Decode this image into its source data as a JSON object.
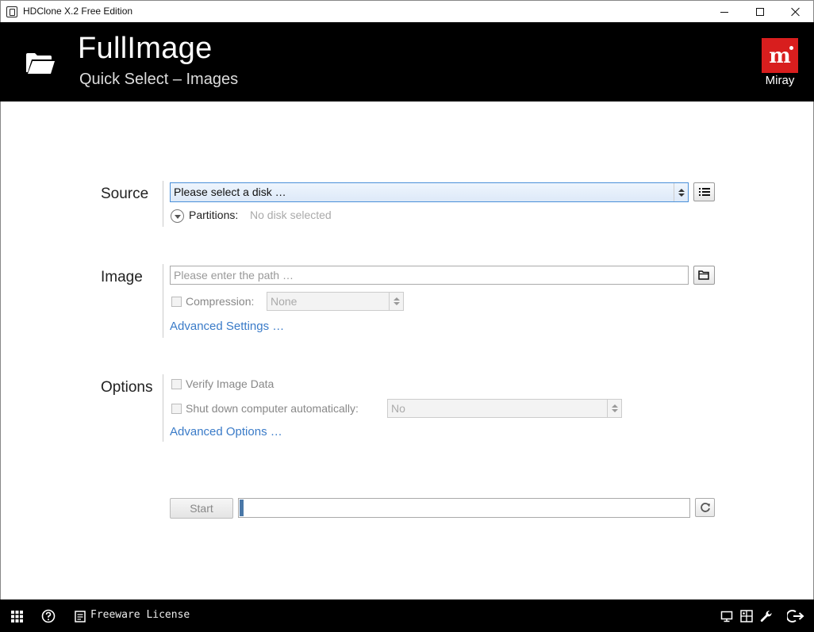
{
  "window": {
    "title": "HDClone X.2 Free Edition"
  },
  "header": {
    "title": "FullImage",
    "subtitle": "Quick Select – Images",
    "brand": "Miray",
    "brand_letter": "m",
    "brand_color": "#d81e1e"
  },
  "source": {
    "label": "Source",
    "disk_select_value": "Please select a disk …",
    "partitions_label": "Partitions:",
    "partitions_value": "No disk selected"
  },
  "image": {
    "label": "Image",
    "path_placeholder": "Please enter the path …",
    "compression_label": "Compression:",
    "compression_value": "None",
    "advanced_settings_link": "Advanced Settings …"
  },
  "options": {
    "label": "Options",
    "verify_label": "Verify Image Data",
    "shutdown_label": "Shut down computer automatically:",
    "shutdown_value": "No",
    "advanced_options_link": "Advanced Options …"
  },
  "actions": {
    "start_label": "Start",
    "progress": 0.0
  },
  "footer": {
    "license_label": "Freeware License"
  },
  "icons": [
    "folder-icon",
    "list-icon",
    "browse-folder-icon",
    "refresh-icon",
    "apps-grid-icon",
    "help-icon",
    "license-document-icon",
    "monitor-icon",
    "network-icon",
    "wrench-icon",
    "exit-icon"
  ]
}
